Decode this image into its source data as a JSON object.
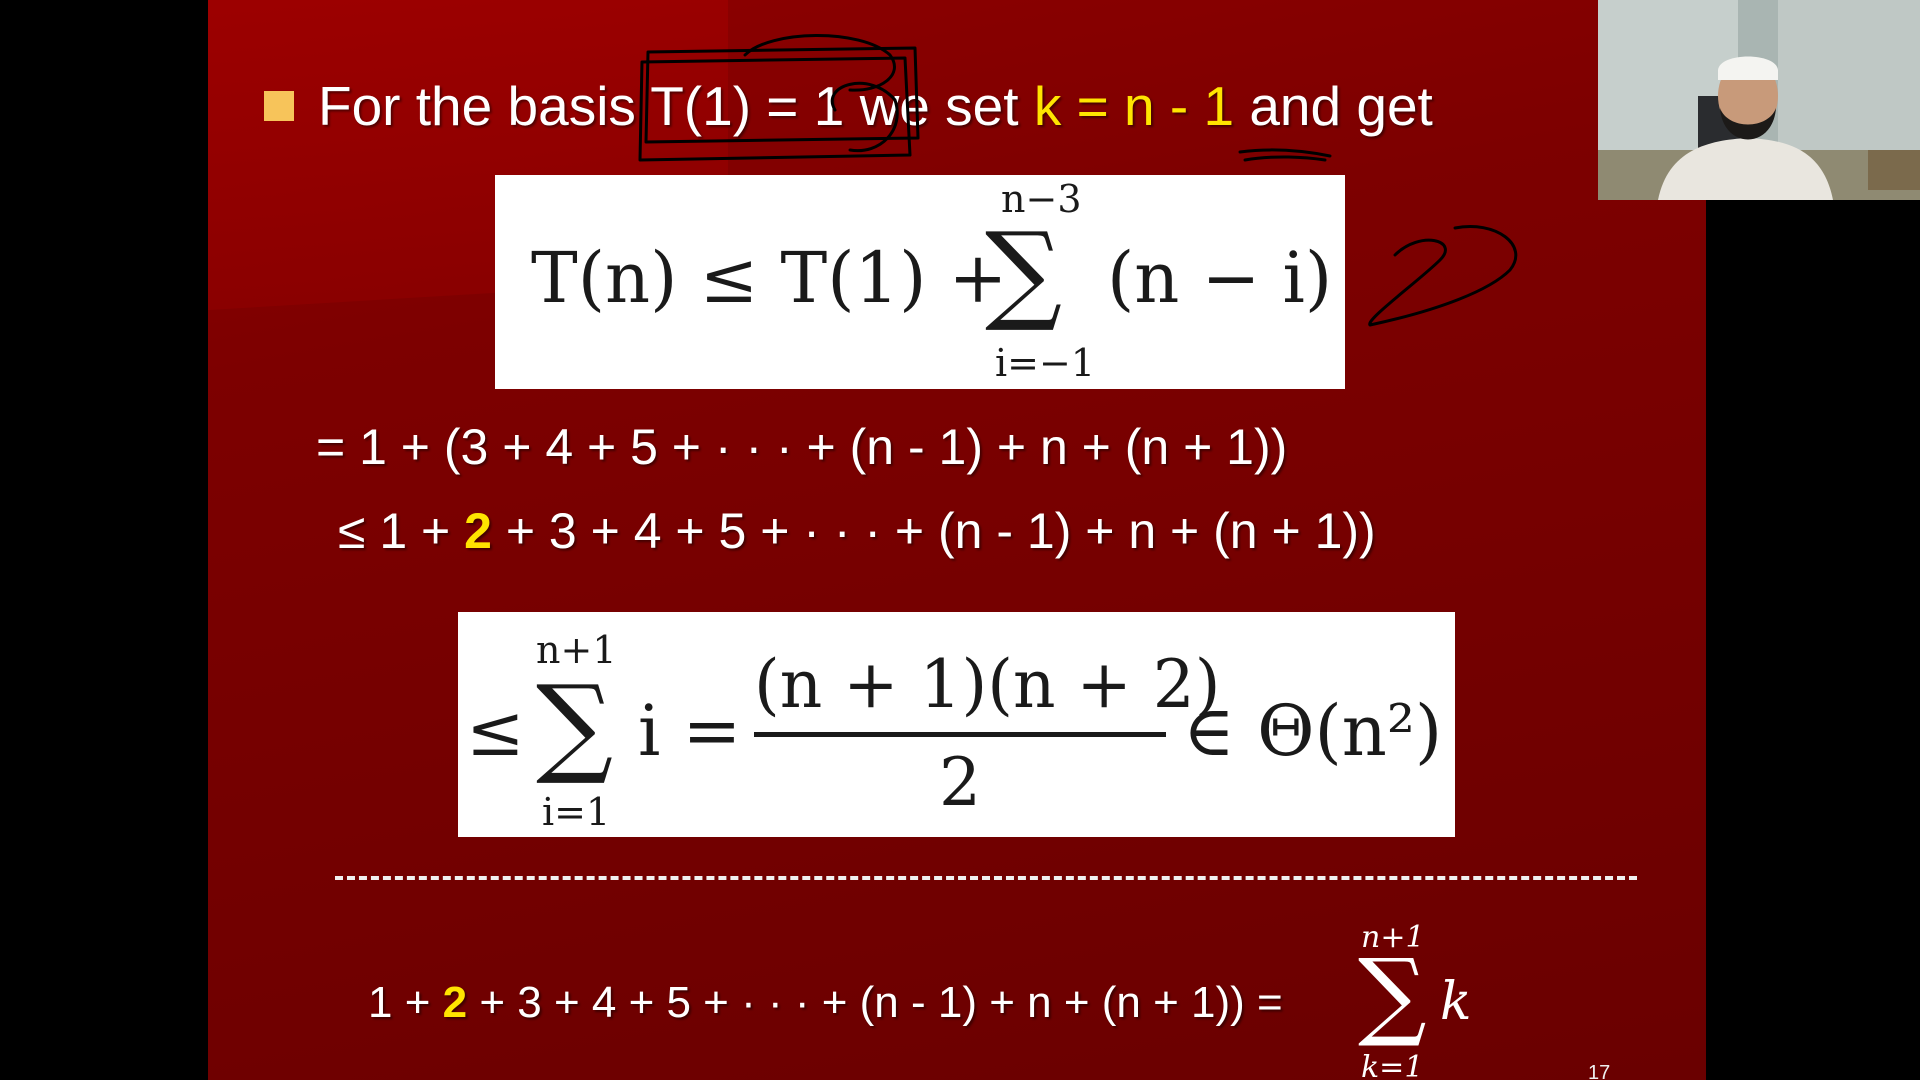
{
  "slide": {
    "bullet": {
      "prefix": "For the basis T(1) = 1 we set ",
      "highlight": "k = n - 1",
      "suffix": " and get"
    },
    "eq1": {
      "lhs": "T(n) ≤ T(1) +",
      "sigma": "∑",
      "upper": "n−3",
      "lower": "i=−1",
      "body": "(n − i)"
    },
    "line1": "= 1 + (3 + 4 + 5 + · · · + (n - 1) + n + (n + 1))",
    "line2": {
      "before": "≤ 1 + ",
      "highlight": "2",
      "after": " + 3 + 4 + 5 + · · · + (n - 1) + n + (n + 1))"
    },
    "eq2": {
      "lead": "≤",
      "sigma": "∑",
      "upper": "n+1",
      "lower": "i=1",
      "var": "i =",
      "numerator": "(n + 1)(n + 2)",
      "denominator": "2",
      "tail": "∈ Θ(n²)"
    },
    "bottom": {
      "before": "1 + ",
      "highlight": "2",
      "after": " + 3 + 4 + 5 + · · · + (n - 1) + n + (n + 1)) =",
      "sigma": "∑",
      "upper": "n+1",
      "lower": "k=1",
      "var": "k"
    },
    "page_number": "17"
  },
  "colors": {
    "slide_bg": "#7d0000",
    "highlight": "#ffe400",
    "bullet": "#f7c45a",
    "ink": "#000000"
  }
}
